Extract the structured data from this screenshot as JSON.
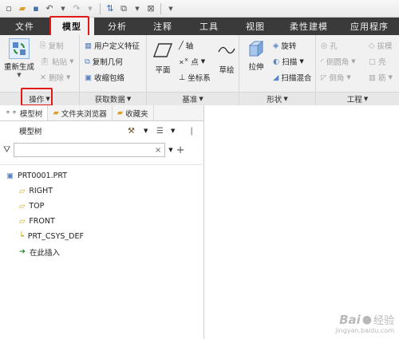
{
  "ribbon_tabs": {
    "file": "文件",
    "model": "模型",
    "analysis": "分析",
    "annotate": "注释",
    "tools": "工具",
    "view": "视图",
    "flexible_modeling": "柔性建模",
    "applications": "应用程序"
  },
  "ribbon": {
    "operations": {
      "regenerate": "重新生成",
      "copy": "复制",
      "paste": "粘贴",
      "delete": "删除",
      "label": "操作"
    },
    "get_data": {
      "user_defined_feature": "用户定义特征",
      "copy_geometry": "复制几何",
      "shrinkwrap": "收缩包络",
      "label": "获取数据"
    },
    "datum": {
      "plane": "平面",
      "axis": "轴",
      "point": "点",
      "csys": "坐标系",
      "sketch": "草绘",
      "label": "基准"
    },
    "shapes": {
      "extrude": "拉伸",
      "revolve": "旋转",
      "sweep": "扫描",
      "swept_blend": "扫描混合",
      "label": "形状"
    },
    "engineering": {
      "hole": "孔",
      "round": "倒圆角",
      "chamfer": "倒角",
      "draft": "拔模",
      "shell": "壳",
      "rib": "筋",
      "label": "工程"
    }
  },
  "panel": {
    "tabs": {
      "model_tree": "模型树",
      "folder_browser": "文件夹浏览器",
      "favorites": "收藏夹"
    },
    "heading": "模型树",
    "tree": {
      "part": "PRT0001.PRT",
      "right": "RIGHT",
      "top": "TOP",
      "front": "FRONT",
      "csys": "PRT_CSYS_DEF",
      "insert_here": "在此插入"
    }
  },
  "watermark": {
    "brand": "Bai",
    "suffix": "经验",
    "url": "jingyan.baidu.com"
  },
  "colors": {
    "tab_bar": "#3a3a3a",
    "highlight_box": "#e01818",
    "datum_plane": "#c8a000",
    "insert_arrow": "#2a8a2a"
  }
}
